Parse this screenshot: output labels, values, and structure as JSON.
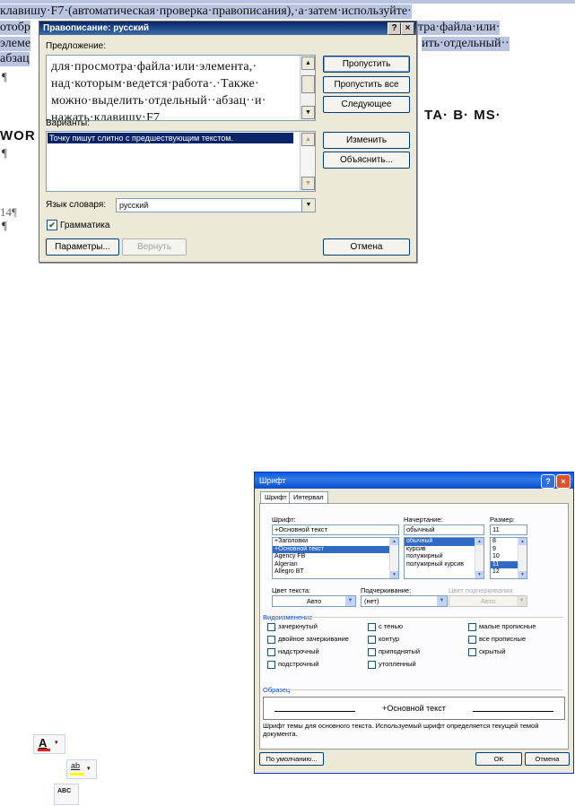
{
  "document": {
    "line1": "клавишу·F7·(автоматическая·проверка·правописания),·а·затем·используйте·",
    "line2_left": "отобр",
    "line2_right": "тра·файла·или·",
    "line3_left": "элеме",
    "line3_right": "ить·отдельный··",
    "line4_left": "абзац",
    "pilcrow": "¶",
    "heading_left": "WOR",
    "heading_right": "ТА·  В·  MS·",
    "page_num": "14¶"
  },
  "spelling_dialog": {
    "title": "Правописание: русский",
    "help_btn": "?",
    "close_btn": "×",
    "sentence_label": "Предложение:",
    "sentence_text": "для·просмотра·файла·или·элемента,·\nнад·которым·ведется·работа·.·Также·\nможно·выделить·отдельный··абзац··и·\nнажать·клавишу·F7",
    "variants_label": "Варианты:",
    "variant_selected": "Точку пишут слитно с предшествующим текстом.",
    "buttons": {
      "skip": "Пропустить",
      "skip_all": "Пропустить все",
      "next": "Следующее",
      "change": "Изменить",
      "explain": "Объяснить...",
      "params": "Параметры...",
      "undo": "Вернуть",
      "cancel": "Отмена"
    },
    "dict_lang_label": "Язык словаря:",
    "dict_lang_value": "русский",
    "grammar_label": "Грамматика",
    "grammar_checked": "✔"
  },
  "font_dialog": {
    "title": "Шрифт",
    "tabs": [
      "Шрифт",
      "Интервал"
    ],
    "font_label": "Шрифт:",
    "font_value": "+Основной текст",
    "font_list": [
      "+Заголовки",
      "+Основной текст",
      "Agency FB",
      "Algerian",
      "Allegro BT"
    ],
    "font_list_selected": 1,
    "style_label": "Начертание:",
    "style_value": "обычный",
    "style_list": [
      "обычный",
      "курсив",
      "полужирный",
      "полужирный курсив"
    ],
    "style_list_selected": 0,
    "size_label": "Размер:",
    "size_value": "11",
    "size_list": [
      "8",
      "9",
      "10",
      "11",
      "12"
    ],
    "size_list_selected": 3,
    "color_label": "Цвет текста:",
    "color_value": "Авто",
    "underline_label": "Подчеркивание:",
    "underline_value": "(нет)",
    "underline_color_label": "Цвет подчеркивания:",
    "underline_color_value": "Авто",
    "effects_label": "Видоизменение",
    "effects": [
      [
        "зачеркнутый",
        "с тенью",
        "малые прописные"
      ],
      [
        "двойное зачеркивание",
        "контур",
        "все прописные"
      ],
      [
        "надстрочный",
        "приподнятый",
        "скрытый"
      ],
      [
        "подстрочный",
        "утопленный",
        ""
      ]
    ],
    "sample_label": "Образец",
    "sample_text": "+Основной текст",
    "description": "Шрифт темы для основного текста. Используемый шрифт определяется текущей темой документа.",
    "buttons": {
      "default": "По умолчанию...",
      "ok": "OK",
      "cancel": "Отмена"
    }
  },
  "toolbar_icons": {
    "font_color": {
      "glyph": "A",
      "color": "#e02020"
    },
    "highlight": {
      "glyph": "ab",
      "color": "#ffff00"
    },
    "check": {
      "glyph": "ABC"
    }
  }
}
